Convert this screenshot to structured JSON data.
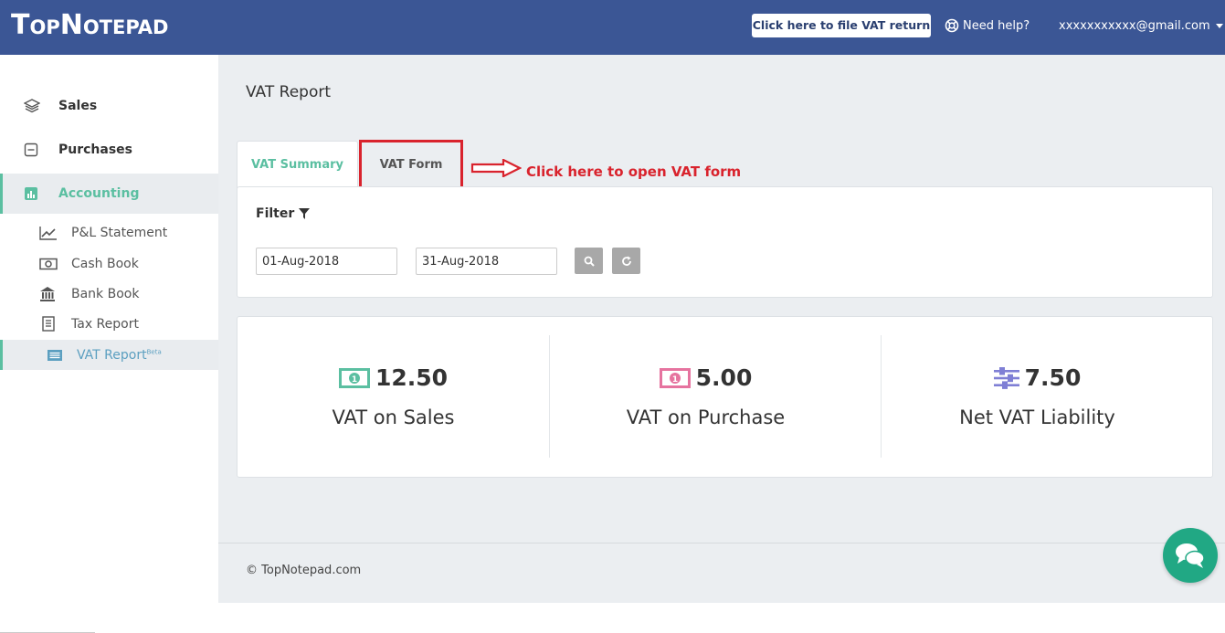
{
  "header": {
    "logo_text": "TopNotepad",
    "file_vat_label": "Click here to file VAT return",
    "help_label": "Need help?",
    "user_email": "xxxxxxxxxxx@gmail.com"
  },
  "sidebar": {
    "main_items": [
      {
        "label": "Sales",
        "icon": "layers-icon"
      },
      {
        "label": "Purchases",
        "icon": "minus-square-icon"
      },
      {
        "label": "Accounting",
        "icon": "bar-chart-icon",
        "active": true
      }
    ],
    "sub_items": [
      {
        "label": "P&L Statement",
        "icon": "line-chart-icon"
      },
      {
        "label": "Cash Book",
        "icon": "money-icon"
      },
      {
        "label": "Bank Book",
        "icon": "bank-icon"
      },
      {
        "label": "Tax Report",
        "icon": "receipt-icon"
      },
      {
        "label": "VAT Report",
        "badge": "Beta",
        "icon": "list-alt-icon",
        "active": true
      }
    ]
  },
  "main": {
    "page_title": "VAT Report",
    "tabs": [
      {
        "label": "VAT Summary",
        "active": true
      },
      {
        "label": "VAT Form",
        "active": false
      }
    ],
    "annotation": "Click here to open VAT form",
    "filter": {
      "title": "Filter",
      "from_date": "01-Aug-2018",
      "to_date": "31-Aug-2018"
    },
    "stats": [
      {
        "value": "12.50",
        "label": "VAT on Sales",
        "icon": "money-icon",
        "color": "#5bbfa1"
      },
      {
        "value": "5.00",
        "label": "VAT on Purchase",
        "icon": "money-icon",
        "color": "#e6739f"
      },
      {
        "value": "7.50",
        "label": "Net VAT Liability",
        "icon": "sliders-icon",
        "color": "#7f7fd5"
      }
    ],
    "footer": "© TopNotepad.com"
  },
  "colors": {
    "header_bg": "#3b5695",
    "accent": "#5bbfa1",
    "annotation": "#d9232d",
    "chat_bg": "#21a884"
  }
}
